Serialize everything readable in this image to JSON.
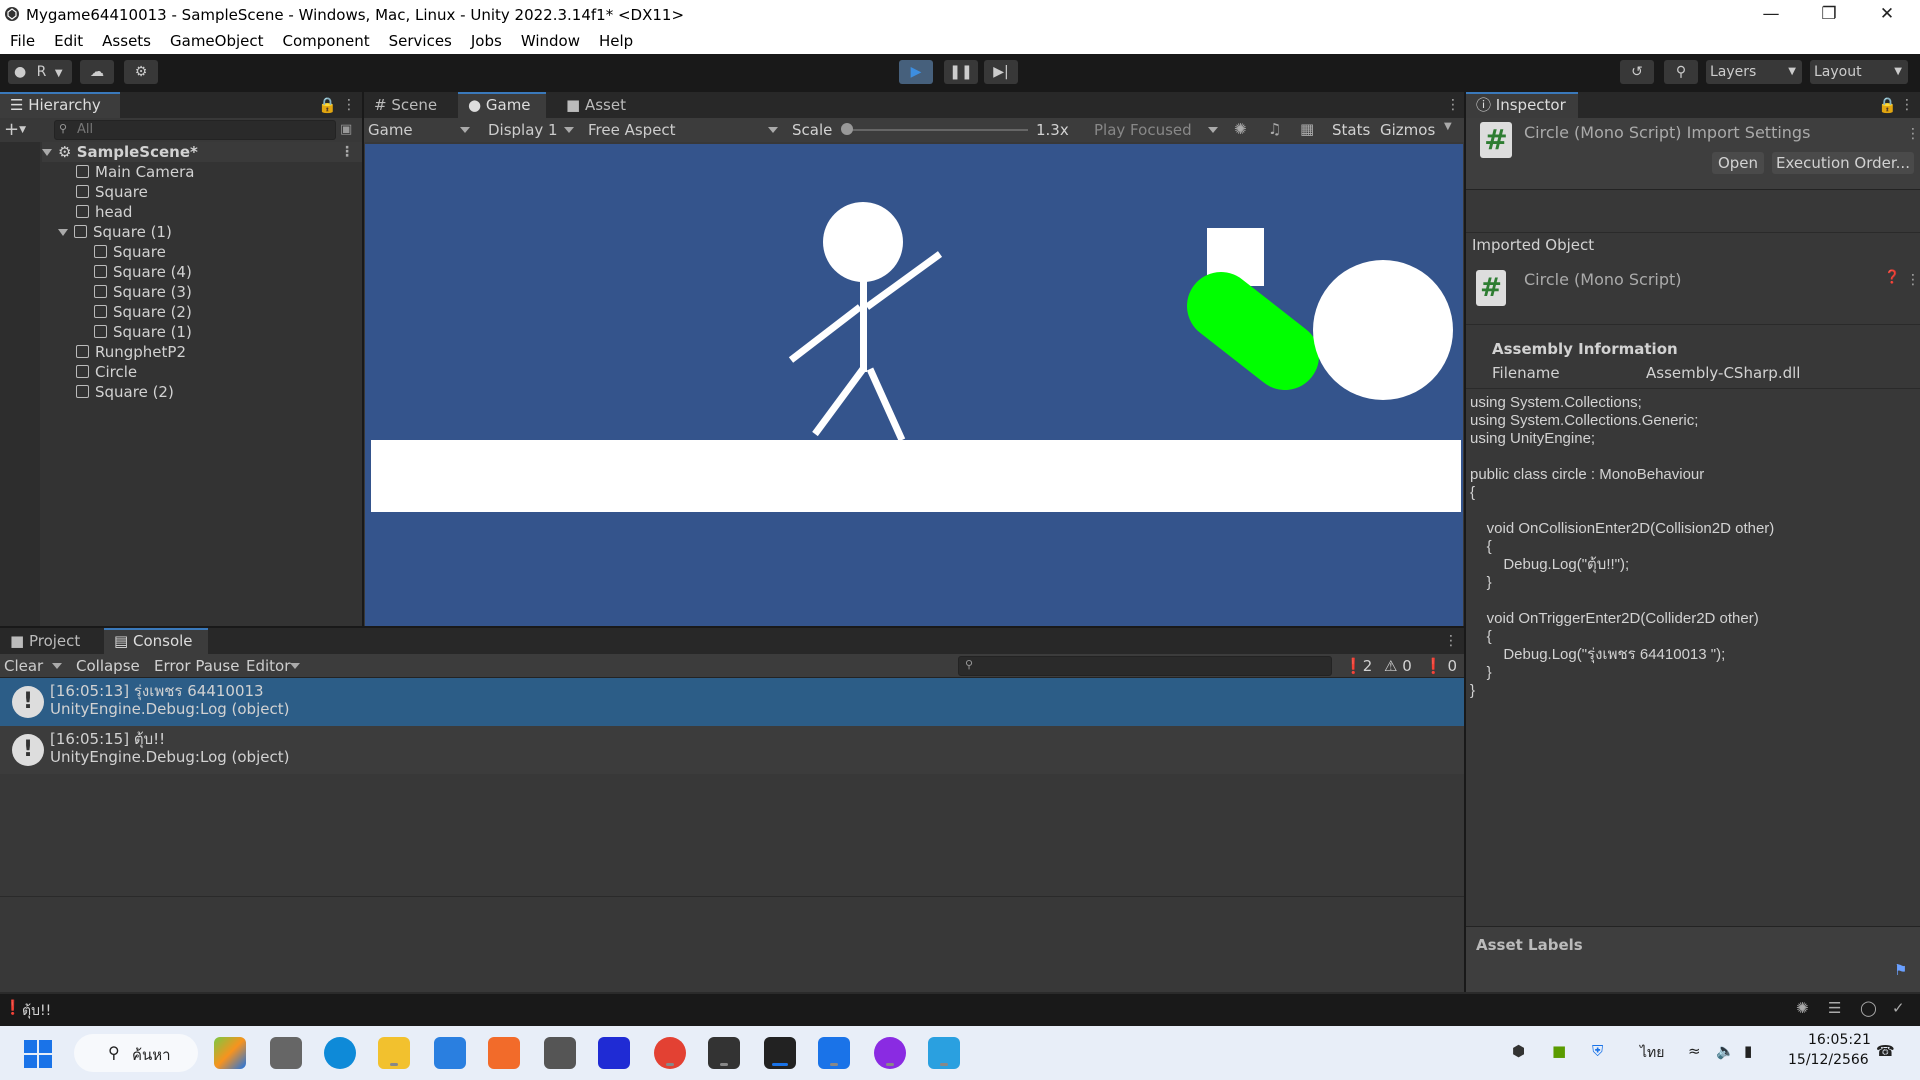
{
  "window": {
    "title": "Mygame64410013 - SampleScene - Windows, Mac, Linux - Unity 2022.3.14f1* <DX11>"
  },
  "menu": [
    "File",
    "Edit",
    "Assets",
    "GameObject",
    "Component",
    "Services",
    "Jobs",
    "Window",
    "Help"
  ],
  "toolbar": {
    "account_label": "R",
    "layers_label": "Layers",
    "layout_label": "Layout"
  },
  "hierarchy": {
    "tab_label": "Hierarchy",
    "search_placeholder": "All",
    "scene_name": "SampleScene*",
    "items": [
      {
        "label": "Main Camera",
        "depth": 1
      },
      {
        "label": "Square",
        "depth": 1
      },
      {
        "label": "head",
        "depth": 1
      },
      {
        "label": "Square (1)",
        "depth": 1,
        "expanded": true
      },
      {
        "label": "Square",
        "depth": 2
      },
      {
        "label": "Square (4)",
        "depth": 2
      },
      {
        "label": "Square (3)",
        "depth": 2
      },
      {
        "label": "Square (2)",
        "depth": 2
      },
      {
        "label": "Square (1)",
        "depth": 2
      },
      {
        "label": "RungphetP2",
        "depth": 1
      },
      {
        "label": "Circle",
        "depth": 1
      },
      {
        "label": "Square (2)",
        "depth": 1
      }
    ]
  },
  "gameview": {
    "tabs": [
      {
        "label": "Scene",
        "icon": "grid-icon"
      },
      {
        "label": "Game",
        "icon": "gamepad-icon",
        "active": true
      },
      {
        "label": "Asset Store",
        "icon": "bag-icon"
      }
    ],
    "view_select": "Game",
    "display_select": "Display 1",
    "aspect_select": "Free Aspect",
    "scale_label": "Scale",
    "scale_value": "1.3x",
    "play_mode_select": "Play Focused",
    "stats_label": "Stats",
    "gizmos_label": "Gizmos",
    "background_color": "#34548c",
    "green_color": "#00ff00"
  },
  "inspector": {
    "tab_label": "Inspector",
    "header_title": "Circle (Mono Script) Import Settings",
    "open_button": "Open",
    "execution_order_button": "Execution Order...",
    "imported_object_label": "Imported Object",
    "object_title": "Circle (Mono Script)",
    "assembly_info_label": "Assembly Information",
    "filename_key": "Filename",
    "filename_value": "Assembly-CSharp.dll",
    "code_lines": [
      "using System.Collections;",
      "using System.Collections.Generic;",
      "using UnityEngine;",
      "",
      "public class circle : MonoBehaviour",
      "{",
      "",
      "    void OnCollisionEnter2D(Collision2D other)",
      "    {",
      "        Debug.Log(\"ตุ้บ!!\");",
      "    }",
      "",
      "    void OnTriggerEnter2D(Collider2D other)",
      "    {",
      "        Debug.Log(\"รุ่งเพชร 64410013 \");",
      "    }",
      "}"
    ],
    "asset_labels_label": "Asset Labels"
  },
  "console": {
    "tabs": [
      {
        "label": "Project",
        "icon": "folder-icon"
      },
      {
        "label": "Console",
        "icon": "console-icon",
        "active": true
      }
    ],
    "clear_label": "Clear",
    "collapse_label": "Collapse",
    "error_pause_label": "Error Pause",
    "editor_label": "Editor",
    "log_count": "2",
    "warn_count": "0",
    "error_count": "0",
    "entries": [
      {
        "line1": "[16:05:13] รุ่งเพชร 64410013",
        "line2": "UnityEngine.Debug:Log (object)",
        "selected": true
      },
      {
        "line1": "[16:05:15] ตุ้บ!!",
        "line2": "UnityEngine.Debug:Log (object)",
        "selected": false
      }
    ]
  },
  "statusbar": {
    "message": "ตุ้บ!!"
  },
  "taskbar": {
    "search_label": "ค้นหา",
    "language": "ไทย",
    "time": "16:05:21",
    "date": "15/12/2566"
  }
}
